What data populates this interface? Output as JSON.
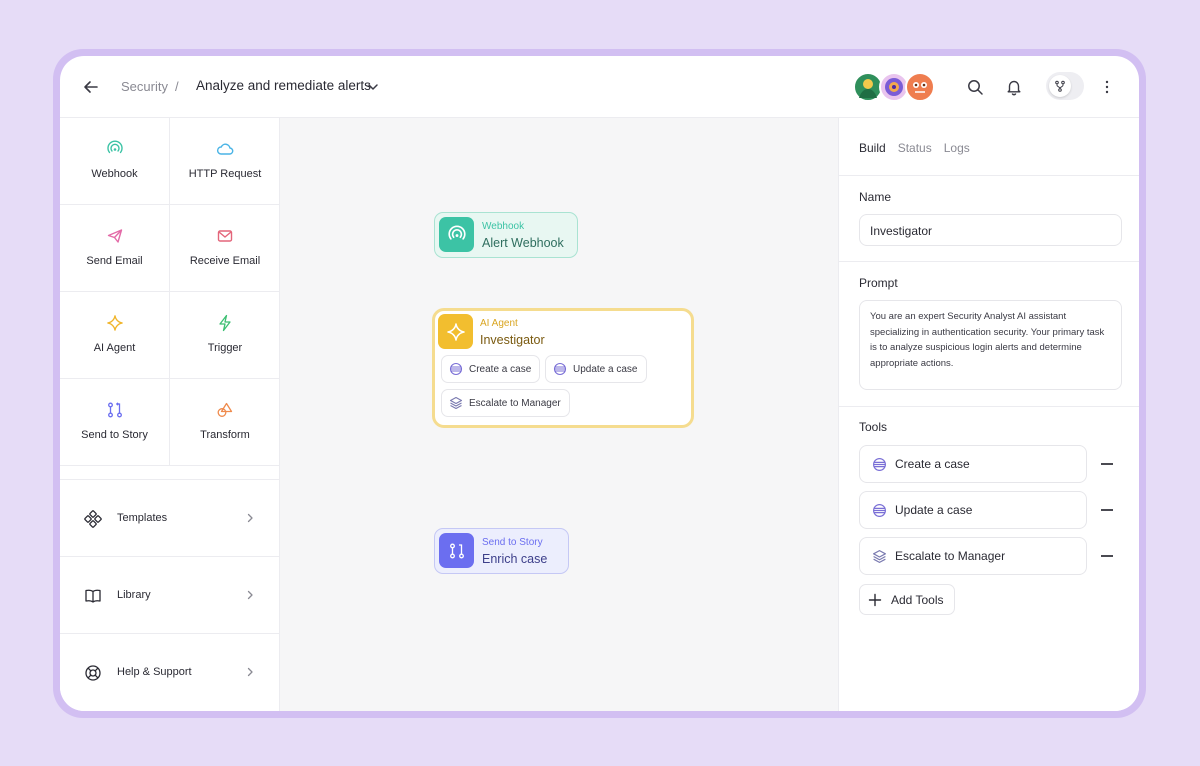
{
  "header": {
    "breadcrumb_parent": "Security",
    "breadcrumb_sep": "/",
    "story_title": "Analyze and remediate alerts"
  },
  "actions": [
    {
      "label": "Webhook",
      "icon": "webhook-icon",
      "color": "#3cc3a5"
    },
    {
      "label": "HTTP Request",
      "icon": "cloud-icon",
      "color": "#4ab4e6"
    },
    {
      "label": "Send Email",
      "icon": "send-icon",
      "color": "#e36aa7"
    },
    {
      "label": "Receive Email",
      "icon": "mail-icon",
      "color": "#e3657a"
    },
    {
      "label": "AI Agent",
      "icon": "sparkle-icon",
      "color": "#f0b429"
    },
    {
      "label": "Trigger",
      "icon": "bolt-icon",
      "color": "#3cbf72"
    },
    {
      "label": "Send to Story",
      "icon": "story-icon",
      "color": "#6b6ef0"
    },
    {
      "label": "Transform",
      "icon": "transform-icon",
      "color": "#ef8a4c"
    }
  ],
  "menu": [
    {
      "label": "Templates",
      "icon": "templates-icon"
    },
    {
      "label": "Library",
      "icon": "book-icon"
    },
    {
      "label": "Help & Support",
      "icon": "lifebuoy-icon"
    }
  ],
  "canvas": {
    "webhook_node": {
      "type": "Webhook",
      "name": "Alert Webhook"
    },
    "agent_node": {
      "type": "AI Agent",
      "name": "Investigator",
      "chips": [
        "Create a case",
        "Update a case",
        "Escalate to Manager"
      ]
    },
    "story_node": {
      "type": "Send to Story",
      "name": "Enrich case"
    }
  },
  "panel": {
    "tabs": [
      "Build",
      "Status",
      "Logs"
    ],
    "active_tab": "Build",
    "name_label": "Name",
    "name_value": "Investigator",
    "prompt_label": "Prompt",
    "prompt_value": "You are an expert Security Analyst AI assistant specializing in authentication security. Your primary task is to analyze suspicious login alerts and determine appropriate actions.",
    "tools_label": "Tools",
    "tools": [
      "Create a case",
      "Update a case",
      "Escalate to Manager"
    ],
    "add_tools_label": "Add Tools"
  },
  "colors": {
    "accent_teal": "#3cc3a5",
    "accent_yellow": "#f2be2f",
    "accent_blue": "#6b6ef0",
    "background": "#e6dcf7"
  }
}
